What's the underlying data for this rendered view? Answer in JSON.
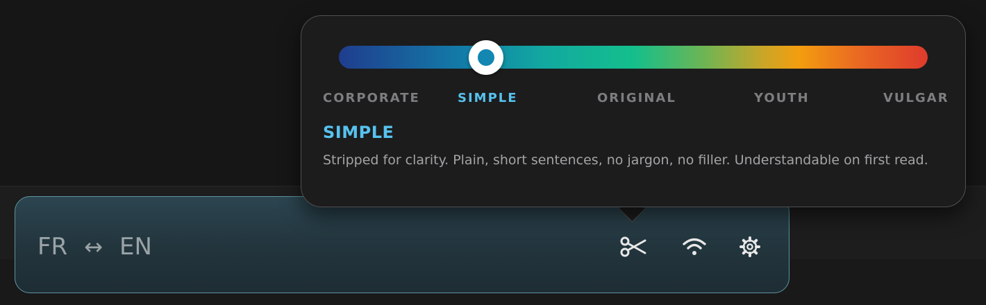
{
  "toolbar": {
    "source_lang": "FR",
    "swap_symbol": "↔",
    "target_lang": "EN",
    "icons": [
      "scissors-icon",
      "wifi-icon",
      "gear-icon"
    ],
    "icon_color": "#e8e8e8",
    "border_color": "#5d95a3"
  },
  "tone_popover": {
    "slider": {
      "value_fraction": 0.25,
      "selected_index": 1,
      "gradient_colors": [
        "#1f3d8e",
        "#127fa9",
        "#14bf8c",
        "#f39e0f",
        "#df3b2c"
      ]
    },
    "labels": [
      "CORPORATE",
      "SIMPLE",
      "ORIGINAL",
      "YOUTH",
      "VULGAR"
    ],
    "selected_title": "SIMPLE",
    "selected_description": "Stripped for clarity. Plain, short sentences, no jargon, no filler. Understandable on first read.",
    "accent_color": "#57c2ee"
  }
}
